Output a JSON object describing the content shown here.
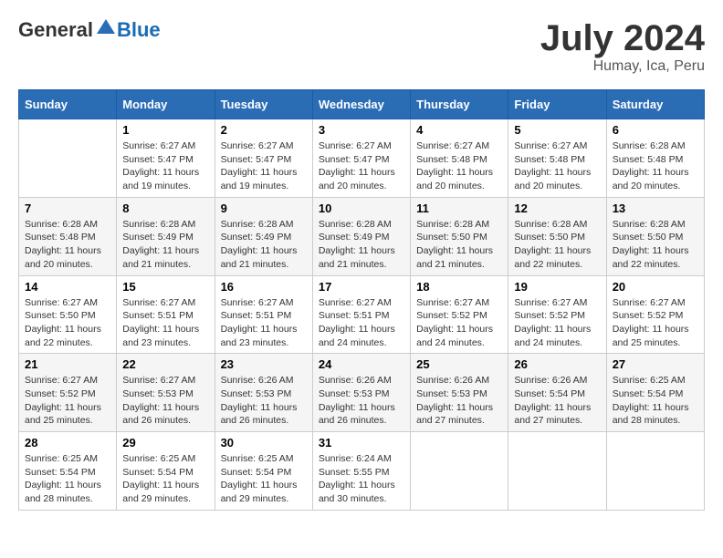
{
  "header": {
    "logo_general": "General",
    "logo_blue": "Blue",
    "title": "July 2024",
    "location": "Humay, Ica, Peru"
  },
  "days_of_week": [
    "Sunday",
    "Monday",
    "Tuesday",
    "Wednesday",
    "Thursday",
    "Friday",
    "Saturday"
  ],
  "weeks": [
    [
      {
        "num": "",
        "info": ""
      },
      {
        "num": "1",
        "info": "Sunrise: 6:27 AM\nSunset: 5:47 PM\nDaylight: 11 hours\nand 19 minutes."
      },
      {
        "num": "2",
        "info": "Sunrise: 6:27 AM\nSunset: 5:47 PM\nDaylight: 11 hours\nand 19 minutes."
      },
      {
        "num": "3",
        "info": "Sunrise: 6:27 AM\nSunset: 5:47 PM\nDaylight: 11 hours\nand 20 minutes."
      },
      {
        "num": "4",
        "info": "Sunrise: 6:27 AM\nSunset: 5:48 PM\nDaylight: 11 hours\nand 20 minutes."
      },
      {
        "num": "5",
        "info": "Sunrise: 6:27 AM\nSunset: 5:48 PM\nDaylight: 11 hours\nand 20 minutes."
      },
      {
        "num": "6",
        "info": "Sunrise: 6:28 AM\nSunset: 5:48 PM\nDaylight: 11 hours\nand 20 minutes."
      }
    ],
    [
      {
        "num": "7",
        "info": "Sunrise: 6:28 AM\nSunset: 5:48 PM\nDaylight: 11 hours\nand 20 minutes."
      },
      {
        "num": "8",
        "info": "Sunrise: 6:28 AM\nSunset: 5:49 PM\nDaylight: 11 hours\nand 21 minutes."
      },
      {
        "num": "9",
        "info": "Sunrise: 6:28 AM\nSunset: 5:49 PM\nDaylight: 11 hours\nand 21 minutes."
      },
      {
        "num": "10",
        "info": "Sunrise: 6:28 AM\nSunset: 5:49 PM\nDaylight: 11 hours\nand 21 minutes."
      },
      {
        "num": "11",
        "info": "Sunrise: 6:28 AM\nSunset: 5:50 PM\nDaylight: 11 hours\nand 21 minutes."
      },
      {
        "num": "12",
        "info": "Sunrise: 6:28 AM\nSunset: 5:50 PM\nDaylight: 11 hours\nand 22 minutes."
      },
      {
        "num": "13",
        "info": "Sunrise: 6:28 AM\nSunset: 5:50 PM\nDaylight: 11 hours\nand 22 minutes."
      }
    ],
    [
      {
        "num": "14",
        "info": "Sunrise: 6:27 AM\nSunset: 5:50 PM\nDaylight: 11 hours\nand 22 minutes."
      },
      {
        "num": "15",
        "info": "Sunrise: 6:27 AM\nSunset: 5:51 PM\nDaylight: 11 hours\nand 23 minutes."
      },
      {
        "num": "16",
        "info": "Sunrise: 6:27 AM\nSunset: 5:51 PM\nDaylight: 11 hours\nand 23 minutes."
      },
      {
        "num": "17",
        "info": "Sunrise: 6:27 AM\nSunset: 5:51 PM\nDaylight: 11 hours\nand 24 minutes."
      },
      {
        "num": "18",
        "info": "Sunrise: 6:27 AM\nSunset: 5:52 PM\nDaylight: 11 hours\nand 24 minutes."
      },
      {
        "num": "19",
        "info": "Sunrise: 6:27 AM\nSunset: 5:52 PM\nDaylight: 11 hours\nand 24 minutes."
      },
      {
        "num": "20",
        "info": "Sunrise: 6:27 AM\nSunset: 5:52 PM\nDaylight: 11 hours\nand 25 minutes."
      }
    ],
    [
      {
        "num": "21",
        "info": "Sunrise: 6:27 AM\nSunset: 5:52 PM\nDaylight: 11 hours\nand 25 minutes."
      },
      {
        "num": "22",
        "info": "Sunrise: 6:27 AM\nSunset: 5:53 PM\nDaylight: 11 hours\nand 26 minutes."
      },
      {
        "num": "23",
        "info": "Sunrise: 6:26 AM\nSunset: 5:53 PM\nDaylight: 11 hours\nand 26 minutes."
      },
      {
        "num": "24",
        "info": "Sunrise: 6:26 AM\nSunset: 5:53 PM\nDaylight: 11 hours\nand 26 minutes."
      },
      {
        "num": "25",
        "info": "Sunrise: 6:26 AM\nSunset: 5:53 PM\nDaylight: 11 hours\nand 27 minutes."
      },
      {
        "num": "26",
        "info": "Sunrise: 6:26 AM\nSunset: 5:54 PM\nDaylight: 11 hours\nand 27 minutes."
      },
      {
        "num": "27",
        "info": "Sunrise: 6:25 AM\nSunset: 5:54 PM\nDaylight: 11 hours\nand 28 minutes."
      }
    ],
    [
      {
        "num": "28",
        "info": "Sunrise: 6:25 AM\nSunset: 5:54 PM\nDaylight: 11 hours\nand 28 minutes."
      },
      {
        "num": "29",
        "info": "Sunrise: 6:25 AM\nSunset: 5:54 PM\nDaylight: 11 hours\nand 29 minutes."
      },
      {
        "num": "30",
        "info": "Sunrise: 6:25 AM\nSunset: 5:54 PM\nDaylight: 11 hours\nand 29 minutes."
      },
      {
        "num": "31",
        "info": "Sunrise: 6:24 AM\nSunset: 5:55 PM\nDaylight: 11 hours\nand 30 minutes."
      },
      {
        "num": "",
        "info": ""
      },
      {
        "num": "",
        "info": ""
      },
      {
        "num": "",
        "info": ""
      }
    ]
  ]
}
